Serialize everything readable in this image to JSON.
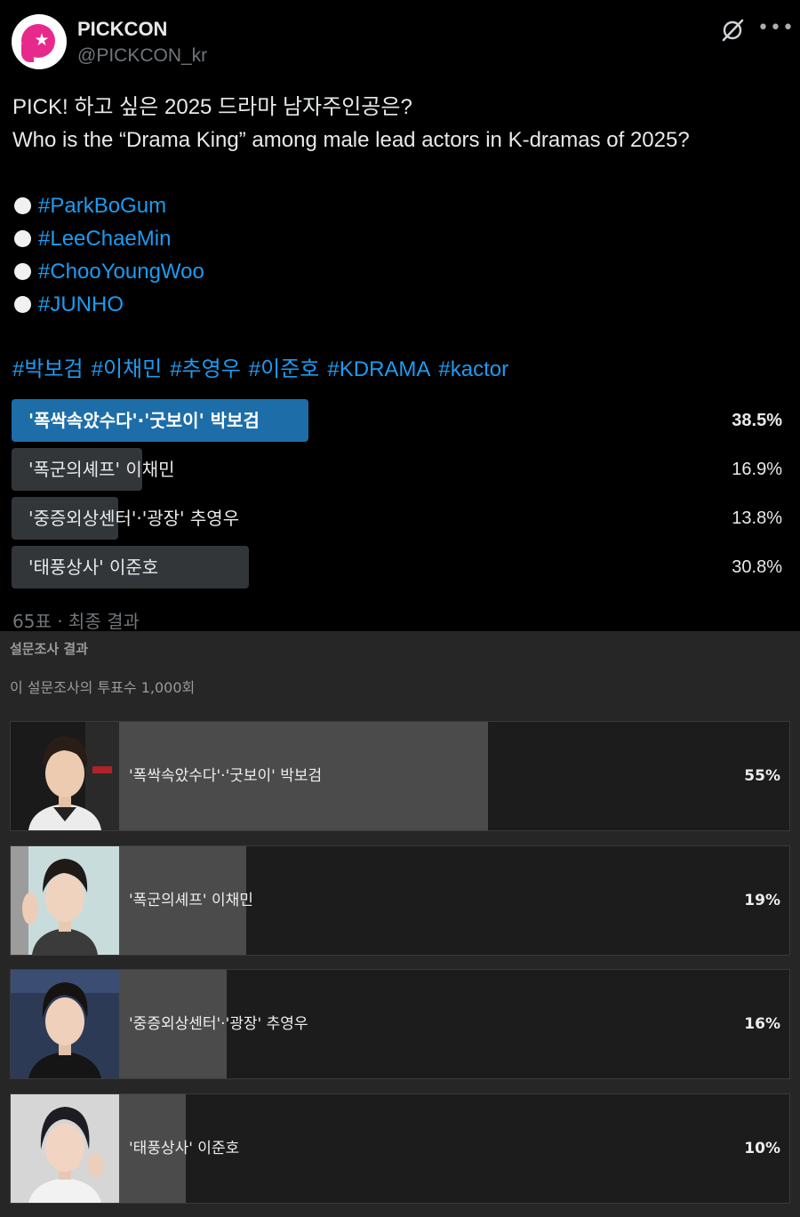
{
  "post": {
    "author_name": "PICKCON",
    "author_handle": "@PICKCON_kr",
    "title_line": "PICK! 하고 싶은 2025 드라마 남자주인공은?",
    "title_line_en": "Who is the “Drama King” among male lead actors in K-dramas of 2025?",
    "hashtag_list": [
      "#ParkBoGum",
      "#LeeChaeMin",
      "#ChooYoungWoo",
      "#JUNHO"
    ],
    "hashtags": [
      "#박보검",
      "#이채민",
      "#추영우",
      "#이준호",
      "#KDRAMA",
      "#kactor"
    ]
  },
  "poll": {
    "options": [
      {
        "label": "'폭싹속았수다'·'굿보이' 박보검",
        "percent_text": "38.5%",
        "percent": 38.5,
        "winner": true
      },
      {
        "label": "'폭군의셰프' 이채민",
        "percent_text": "16.9%",
        "percent": 16.9,
        "winner": false
      },
      {
        "label": "'중증외상센터'·'광장' 추영우",
        "percent_text": "13.8%",
        "percent": 13.8,
        "winner": false
      },
      {
        "label": "'태풍상사' 이준호",
        "percent_text": "30.8%",
        "percent": 30.8,
        "winner": false
      }
    ],
    "footer": "65표 · 최종 결과"
  },
  "results": {
    "title": "설문조사 결과",
    "votes_text": "이 설문조사의 투표수 1,000회",
    "options": [
      {
        "label": "'폭싹속았수다'·'굿보이' 박보검",
        "percent_text": "55%",
        "percent": 55
      },
      {
        "label": "'폭군의셰프' 이채민",
        "percent_text": "19%",
        "percent": 19
      },
      {
        "label": "'중증외상센터'·'광장' 추영우",
        "percent_text": "16%",
        "percent": 16
      },
      {
        "label": "'태풍상사' 이준호",
        "percent_text": "10%",
        "percent": 10
      }
    ]
  },
  "colors": {
    "link": "#1d9bf0",
    "winner_bar": "#1d6ea8",
    "bar": "#333639",
    "result_bar": "#4b4b4b",
    "brand": "#e8298c"
  },
  "icons": [
    "grok-icon",
    "more-icon",
    "bullet-icon"
  ]
}
